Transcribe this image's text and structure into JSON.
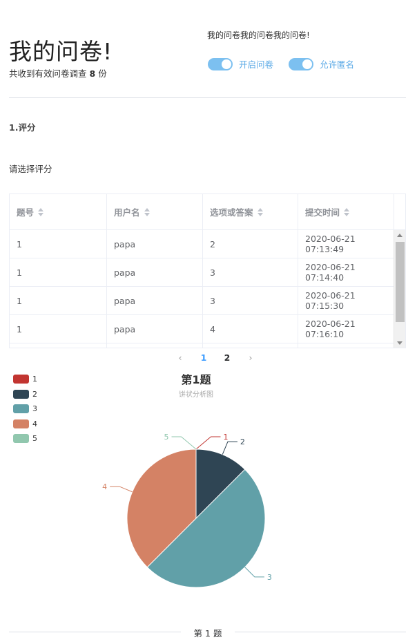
{
  "header": {
    "title": "我的问卷!",
    "subtitle_prefix": "共收到有效问卷调查",
    "count": "8",
    "subtitle_suffix": "份",
    "notice": "我的问卷我的问卷我的问卷!",
    "switch_open_label": "开启问卷",
    "switch_anon_label": "允许匿名"
  },
  "question": {
    "title": "1.评分",
    "prompt": "请选择评分"
  },
  "table": {
    "columns": [
      "题号",
      "用户名",
      "选项或答案",
      "提交时间"
    ],
    "rows": [
      [
        "1",
        "papa",
        "2",
        "2020-06-21 07:13:49"
      ],
      [
        "1",
        "papa",
        "3",
        "2020-06-21 07:14:40"
      ],
      [
        "1",
        "papa",
        "3",
        "2020-06-21 07:15:30"
      ],
      [
        "1",
        "papa",
        "4",
        "2020-06-21 07:16:10"
      ]
    ]
  },
  "pagination": {
    "prev_icon": "chevron-left-icon",
    "pages": [
      "1",
      "2"
    ],
    "current": "1",
    "next_icon": "chevron-right-icon"
  },
  "chart_data": {
    "type": "pie",
    "title": "第1题",
    "subtitle": "饼状分析图",
    "categories": [
      "1",
      "2",
      "3",
      "4",
      "5"
    ],
    "values": [
      0,
      1,
      4,
      3,
      0
    ],
    "colors": [
      "#c23531",
      "#2f4554",
      "#61a0a8",
      "#d48265",
      "#91c7ae"
    ],
    "legend_position": "top-left"
  },
  "footer": {
    "label": "第 1 题"
  }
}
